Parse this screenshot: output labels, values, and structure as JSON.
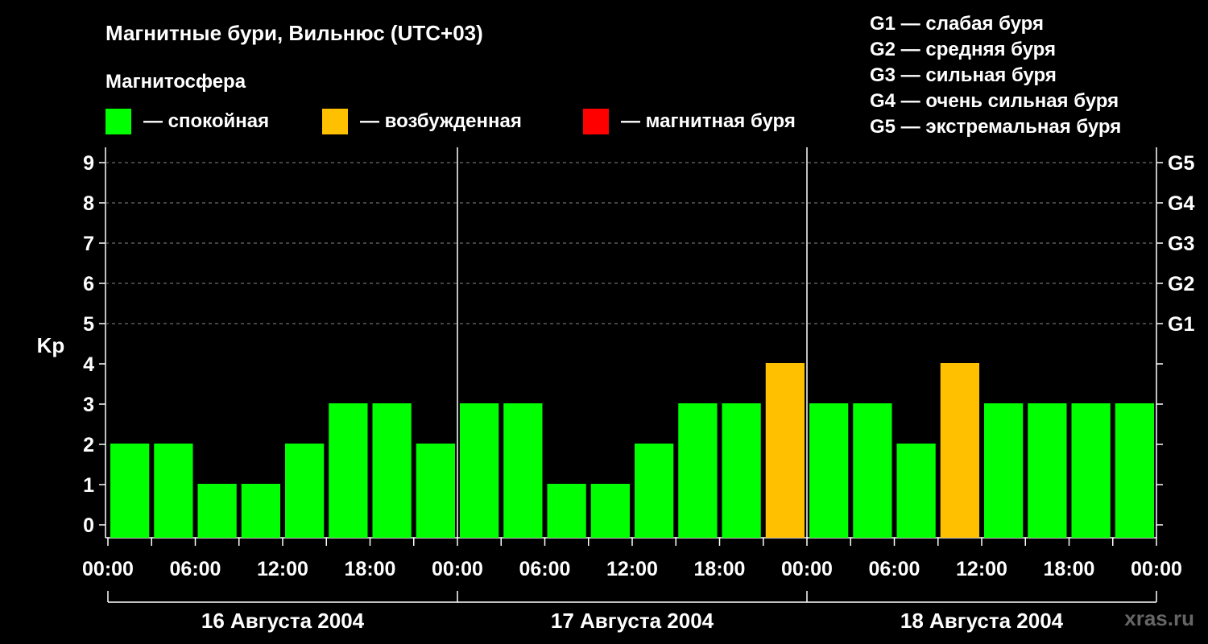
{
  "title": "Магнитные бури, Вильнюс (UTC+03)",
  "legend": {
    "heading": "Магнитосфера",
    "items": [
      {
        "color": "#00ff00",
        "label": "— спокойная"
      },
      {
        "color": "#ffc000",
        "label": "— возбужденная"
      },
      {
        "color": "#ff0000",
        "label": "— магнитная буря"
      }
    ]
  },
  "storm_levels": [
    "G1 — слабая буря",
    "G2 — средняя буря",
    "G3 — сильная буря",
    "G4 — очень сильная буря",
    "G5 — экстремальная буря"
  ],
  "watermark": "xras.ru",
  "chart_data": {
    "type": "bar",
    "ylabel": "Kp",
    "ylim": [
      0,
      9
    ],
    "y_ticks": [
      "0",
      "1",
      "2",
      "3",
      "4",
      "5",
      "6",
      "7",
      "8",
      "9"
    ],
    "right_axis_labels": [
      {
        "kp": 5,
        "label": "G1"
      },
      {
        "kp": 6,
        "label": "G2"
      },
      {
        "kp": 7,
        "label": "G3"
      },
      {
        "kp": 8,
        "label": "G4"
      },
      {
        "kp": 9,
        "label": "G5"
      }
    ],
    "x_tick_labels": [
      "00:00",
      "06:00",
      "12:00",
      "18:00",
      "00:00",
      "06:00",
      "12:00",
      "18:00",
      "00:00",
      "06:00",
      "12:00",
      "18:00",
      "00:00"
    ],
    "days": [
      "16 Августа 2004",
      "17 Августа 2004",
      "18 Августа 2004"
    ],
    "interval_hours": 3,
    "series": [
      {
        "values": [
          2,
          2,
          1,
          1,
          2,
          3,
          3,
          2,
          3,
          3,
          1,
          1,
          2,
          3,
          3,
          4,
          3,
          3,
          2,
          4,
          3,
          3,
          3,
          3
        ]
      }
    ],
    "colors": {
      "quiet": "#00ff00",
      "active": "#ffc000",
      "storm": "#ff0000"
    },
    "grid": "dashed at Kp 5-9"
  }
}
